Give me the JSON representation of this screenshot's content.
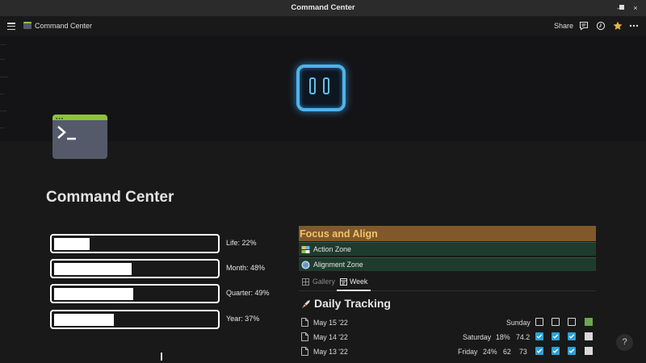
{
  "window": {
    "title": "Command Center"
  },
  "topbar": {
    "breadcrumb": "Command Center",
    "share_label": "Share"
  },
  "page": {
    "title": "Command Center"
  },
  "progress": [
    {
      "label": "Life: 22%",
      "value": 0.22
    },
    {
      "label": "Month: 48%",
      "value": 0.48
    },
    {
      "label": "Quarter: 49%",
      "value": 0.49
    },
    {
      "label": "Year: 37%",
      "value": 0.37
    }
  ],
  "focus": {
    "title": "Focus and Align",
    "zones": [
      "Action Zone",
      "Alignment Zone"
    ]
  },
  "views": {
    "gallery": "Gallery",
    "week": "Week",
    "active": "Week"
  },
  "daily": {
    "title": "Daily Tracking",
    "rows": [
      {
        "date": "May 15 '22",
        "day": "Sunday",
        "pct": "",
        "a": "",
        "b": "",
        "checks": [
          false,
          false,
          false
        ],
        "status_color": "#6aa84f"
      },
      {
        "date": "May 14 '22",
        "day": "Saturday",
        "pct": "18%",
        "a": "74.2",
        "b": "",
        "checks": [
          true,
          true,
          true
        ],
        "status_color": "#d9d9d9"
      },
      {
        "date": "May 13 '22",
        "day": "Friday",
        "pct": "24%",
        "a": "62",
        "b": "73",
        "checks": [
          true,
          true,
          true
        ],
        "status_color": "#d9d9d9"
      }
    ]
  },
  "help": {
    "label": "?"
  },
  "colors": {
    "accent_blue": "#2ea0d6",
    "focus_bg": "#80592a",
    "zone_bg": "#1f3b2d"
  }
}
